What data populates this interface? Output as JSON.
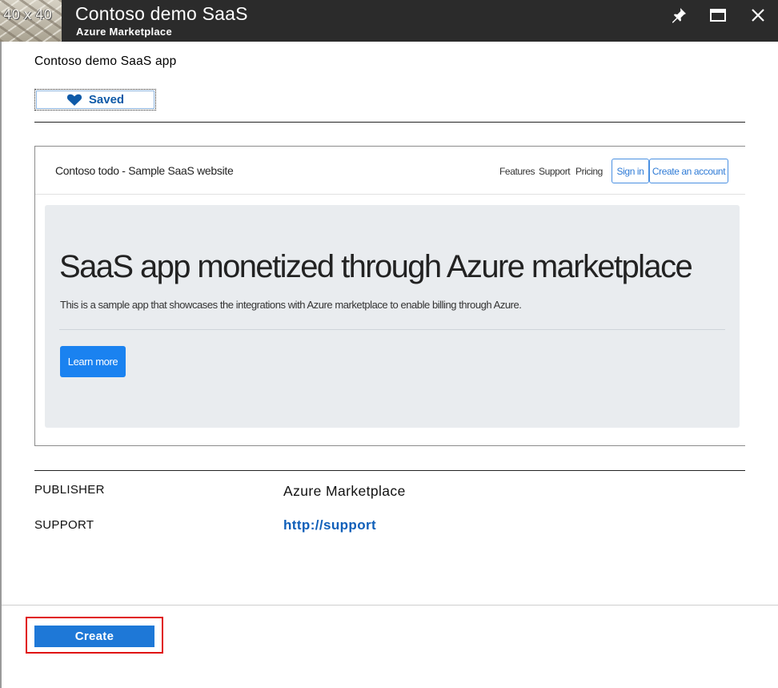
{
  "header": {
    "thumbnail_text": "40 x 40",
    "title": "Contoso demo SaaS",
    "subtitle": "Azure Marketplace",
    "buttons": {
      "pin_icon": "pin-icon",
      "maximize_icon": "maximize-icon",
      "close_icon": "close-icon"
    },
    "background_color": "#2b2b2b"
  },
  "offer": {
    "name": "Contoso demo SaaS app",
    "saved_label": "Saved",
    "saved_icon": "heart-icon",
    "accent_color": "#0e5aa8"
  },
  "preview": {
    "brand": "Contoso todo - Sample SaaS website",
    "nav_links": [
      "Features",
      "Support",
      "Pricing"
    ],
    "sign_in": "Sign in",
    "create_account": "Create an account",
    "headline": "SaaS app monetized through Azure marketplace",
    "lead": "This is a sample app that showcases the integrations with Azure marketplace to enable billing through Azure.",
    "learn_more": "Learn more",
    "button_color": "#1a82f0"
  },
  "details": {
    "publisher_label": "PUBLISHER",
    "publisher_value": "Azure Marketplace",
    "support_label": "SUPPORT",
    "support_value": "http://support",
    "link_color": "#0f5fb9"
  },
  "footer": {
    "create_label": "Create",
    "create_color": "#1e78d7",
    "highlight_color": "#e01010"
  }
}
